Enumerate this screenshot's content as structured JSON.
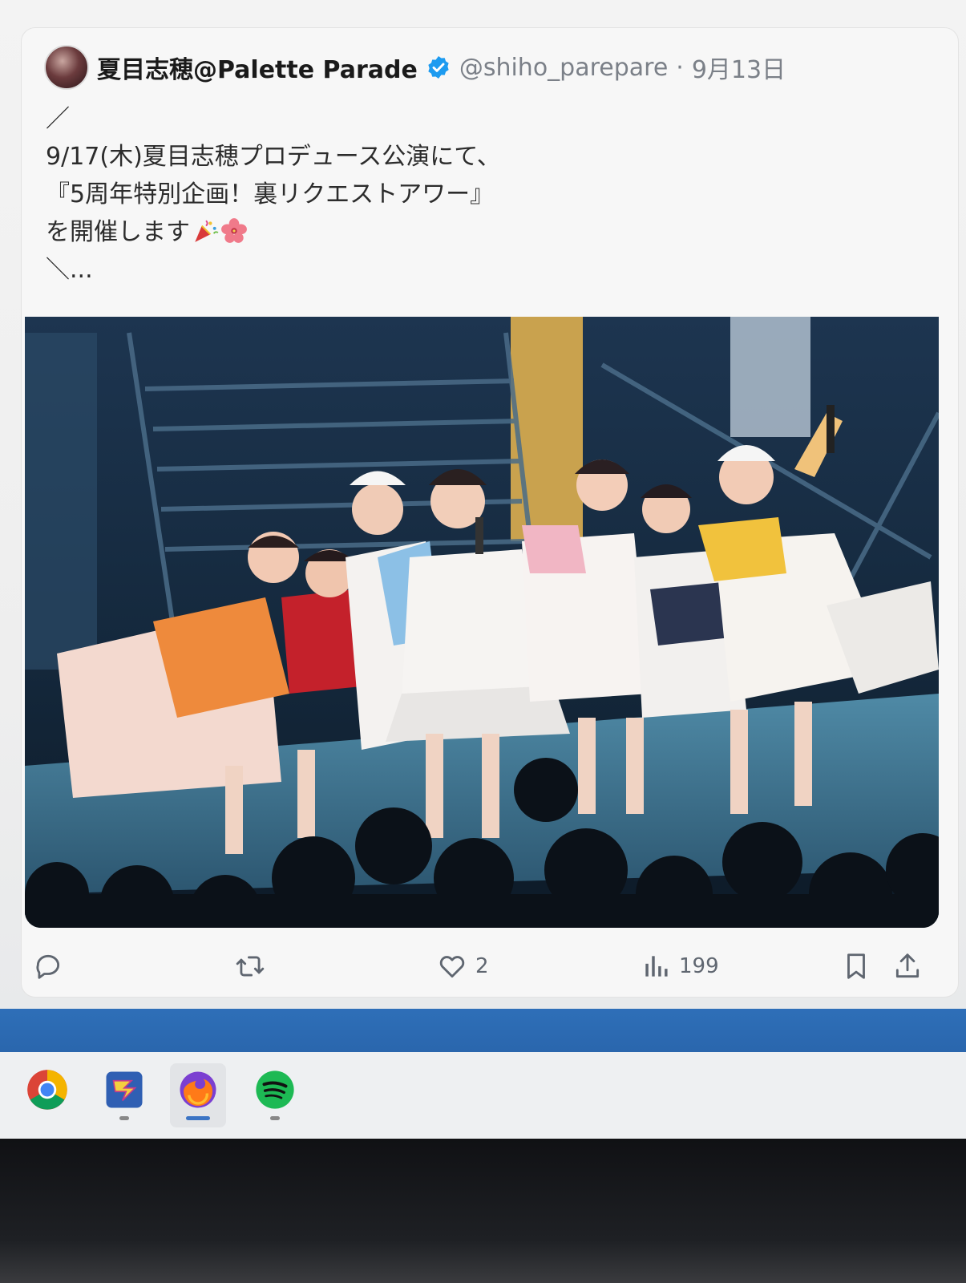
{
  "tweet": {
    "display_name": "夏目志穂@Palette Parade",
    "handle": "@shiho_parepare",
    "separator": "·",
    "date": "9月13日",
    "text_lines": [
      "／",
      "9/17(木)夏目志穂プロデュース公演にて、",
      "『5周年特別企画！裏リクエストアワー』",
      "を開催します",
      "＼..."
    ],
    "emojis": [
      "party-popper-icon",
      "hibiscus-icon"
    ],
    "photo_description_icon": "stage-photo"
  },
  "actions": {
    "reply_icon": "reply-icon",
    "retweet_icon": "retweet-icon",
    "like_icon": "heart-icon",
    "like_count": "2",
    "views_icon": "bar-chart-icon",
    "views_count": "199",
    "bookmark_icon": "bookmark-icon",
    "share_icon": "share-icon"
  },
  "taskbar": {
    "apps": [
      {
        "name": "chrome-icon",
        "running": true
      },
      {
        "name": "app-icon",
        "running": true
      },
      {
        "name": "firefox-icon",
        "running": true,
        "active": true
      },
      {
        "name": "spotify-icon",
        "running": true
      }
    ]
  },
  "colors": {
    "verified_blue": "#1d9bf0",
    "muted_text": "#7b8088",
    "accent_blue_band": "#2e6fb8"
  }
}
